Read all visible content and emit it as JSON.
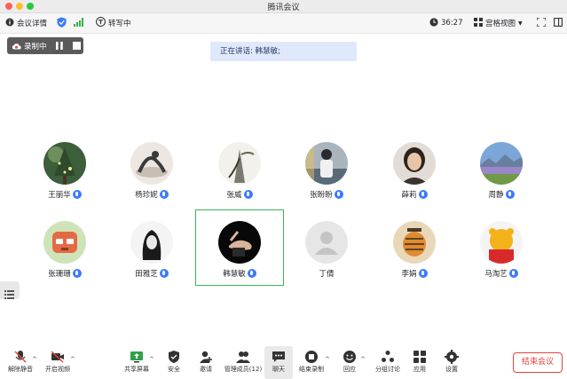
{
  "window": {
    "title": "腾讯会议"
  },
  "infobar": {
    "meeting_details": "会议详情",
    "transcribe": "转写中",
    "timer": "36:27",
    "view_mode": "宫格视图"
  },
  "recording": {
    "label": "录制中"
  },
  "speaking": {
    "text": "正在讲话: 韩慧敏;"
  },
  "participants": [
    {
      "name": "王丽华",
      "avatar": "tree-photo"
    },
    {
      "name": "杨珍妮",
      "avatar": "yoga-photo"
    },
    {
      "name": "张威",
      "avatar": "ink-painting"
    },
    {
      "name": "张盼盼",
      "avatar": "person-photo"
    },
    {
      "name": "薛莉",
      "avatar": "portrait-photo"
    },
    {
      "name": "周静",
      "avatar": "landscape-photo"
    },
    {
      "name": "张珊珊",
      "avatar": "cartoon-photo"
    },
    {
      "name": "田雅芝",
      "avatar": "sketch-photo"
    },
    {
      "name": "韩慧敏",
      "avatar": "hand-photo"
    },
    {
      "name": "丁倩",
      "avatar": "default-avatar"
    },
    {
      "name": "李娟",
      "avatar": "tiger-photo"
    },
    {
      "name": "马淘艺",
      "avatar": "bear-photo"
    }
  ],
  "toolbar": {
    "unmute": "解除静音",
    "start_video": "开启视频",
    "share_screen": "共享屏幕",
    "security": "安全",
    "invite": "邀请",
    "manage_members": "管理成员(12)",
    "chat": "聊天",
    "end_recording": "结束录制",
    "reactions": "回应",
    "breakout": "分组讨论",
    "apps": "应用",
    "settings": "设置",
    "end_meeting": "结束会议"
  },
  "colors": {
    "accent": "#3a7afe",
    "end": "#e0443a",
    "active_speaker": "#3cb35a"
  }
}
